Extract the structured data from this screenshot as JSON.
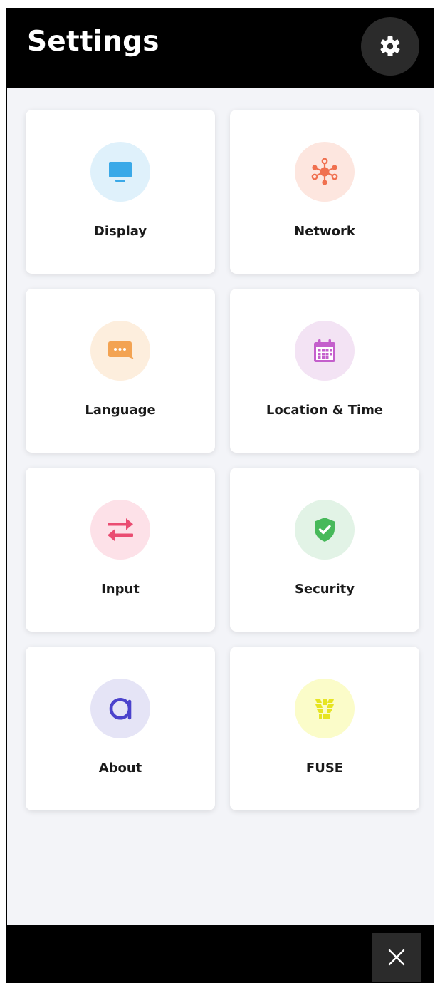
{
  "header": {
    "title": "Settings",
    "settings_icon": "gear-icon"
  },
  "cards": [
    {
      "label": "Display",
      "icon": "monitor-icon",
      "bg": "#dff1fb",
      "fg": "#3aa9e8"
    },
    {
      "label": "Network",
      "icon": "network-icon",
      "bg": "#fde6df",
      "fg": "#f0704f"
    },
    {
      "label": "Language",
      "icon": "chat-bubble-icon",
      "bg": "#fdeedd",
      "fg": "#f3a352"
    },
    {
      "label": "Location & Time",
      "icon": "calendar-icon",
      "bg": "#f3e3f4",
      "fg": "#c45fcc"
    },
    {
      "label": "Input",
      "icon": "swap-arrows-icon",
      "bg": "#fde1e8",
      "fg": "#ea4d72"
    },
    {
      "label": "Security",
      "icon": "shield-check-icon",
      "bg": "#e2f3e6",
      "fg": "#47b95a"
    },
    {
      "label": "About",
      "icon": "about-logo-icon",
      "bg": "#e5e4f6",
      "fg": "#4b42cc"
    },
    {
      "label": "FUSE",
      "icon": "fuse-logo-icon",
      "bg": "#fbfcc9",
      "fg": "#e6e422"
    }
  ],
  "footer": {
    "close_icon": "close-icon"
  }
}
